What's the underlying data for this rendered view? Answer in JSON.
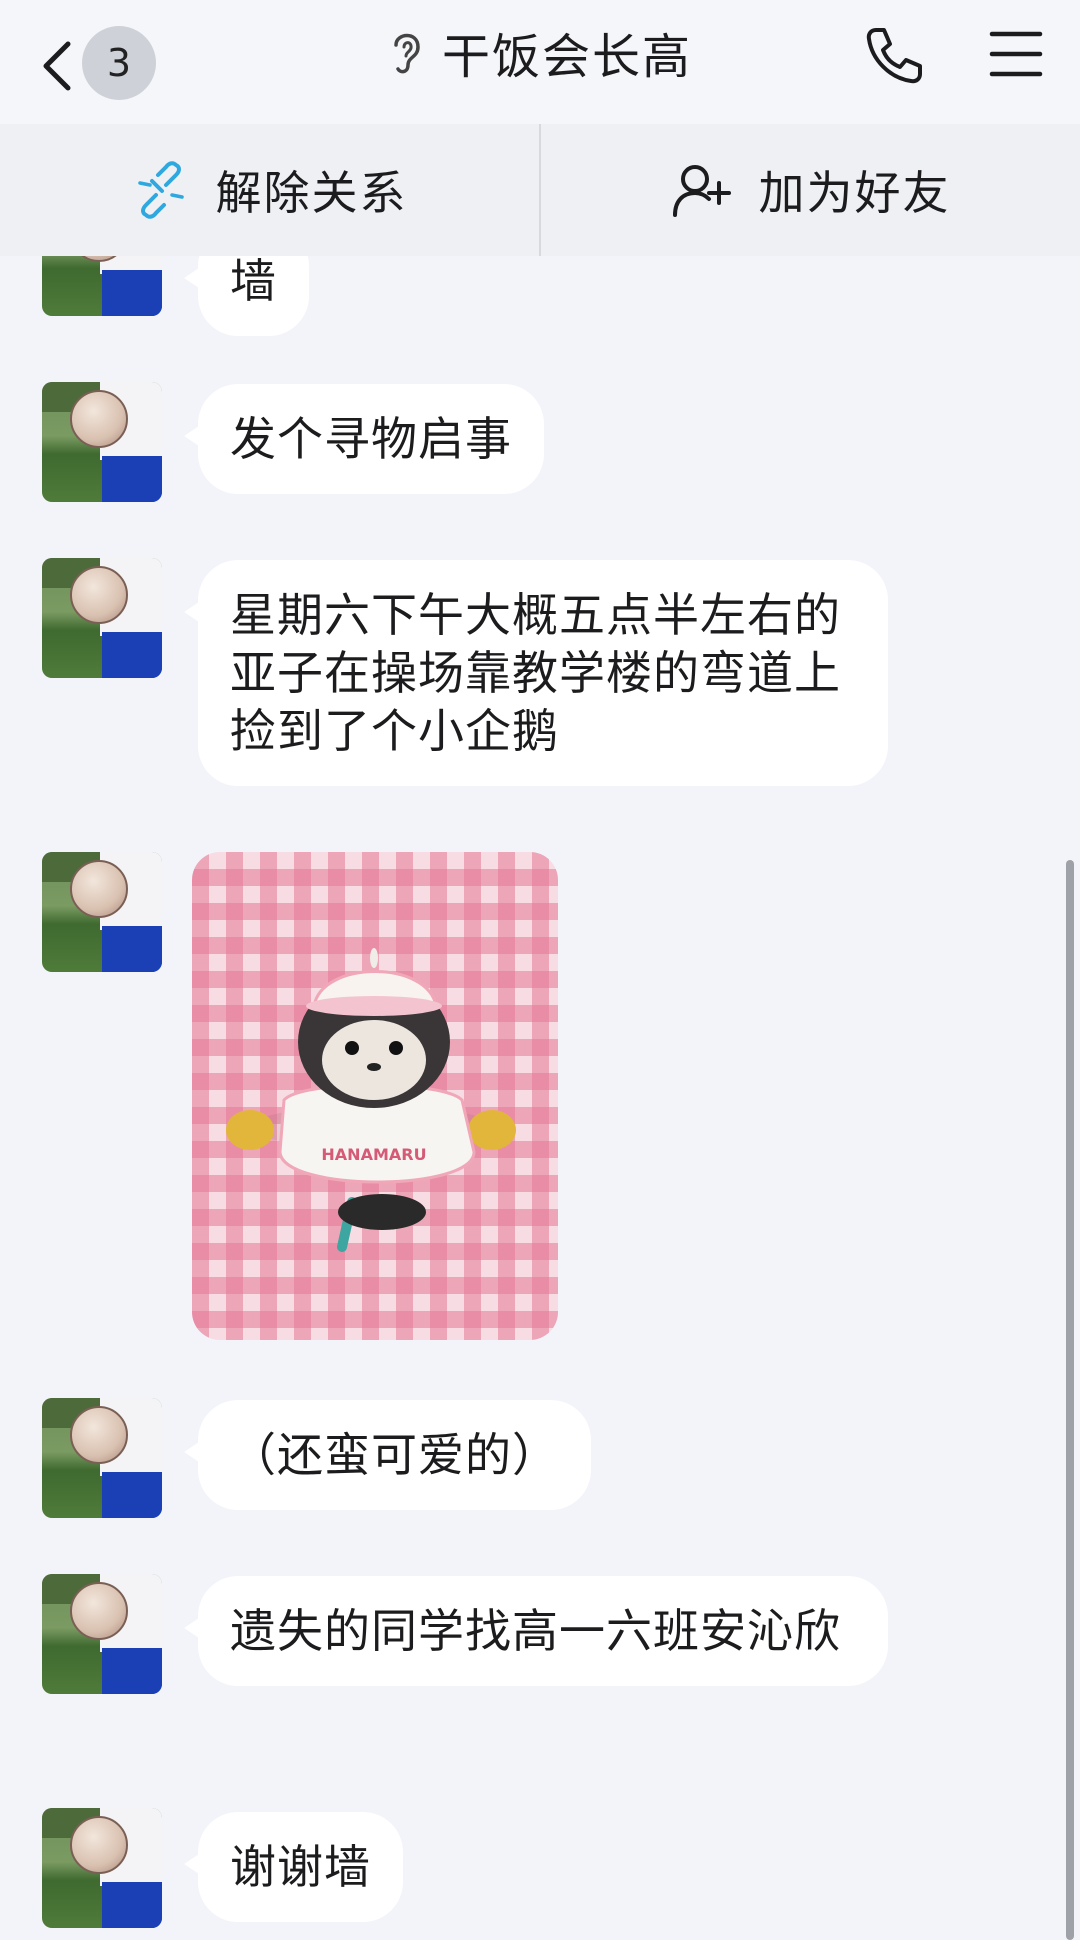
{
  "header": {
    "unread_count": "3",
    "title": "干饭会长高",
    "icons": {
      "back": "chevron-left-icon",
      "ear": "ear-icon",
      "phone": "phone-icon",
      "menu": "hamburger-menu-icon"
    }
  },
  "actions": {
    "unlink_label": "解除关系",
    "add_friend_label": "加为好友",
    "accent_color": "#2fa8e0"
  },
  "messages": [
    {
      "type": "text",
      "text": "墙"
    },
    {
      "type": "text",
      "text": "发个寻物启事"
    },
    {
      "type": "text",
      "text": "星期六下午大概五点半左右的亚子在操场靠教学楼的弯道上捡到了个小企鹅"
    },
    {
      "type": "image",
      "content": "penguin-plush-photo",
      "plush_text": "HANAMARU"
    },
    {
      "type": "text",
      "text": "（还蛮可爱的）"
    },
    {
      "type": "text",
      "text": "遗失的同学找高一六班安沁欣"
    },
    {
      "type": "text",
      "text": "谢谢墙"
    }
  ]
}
